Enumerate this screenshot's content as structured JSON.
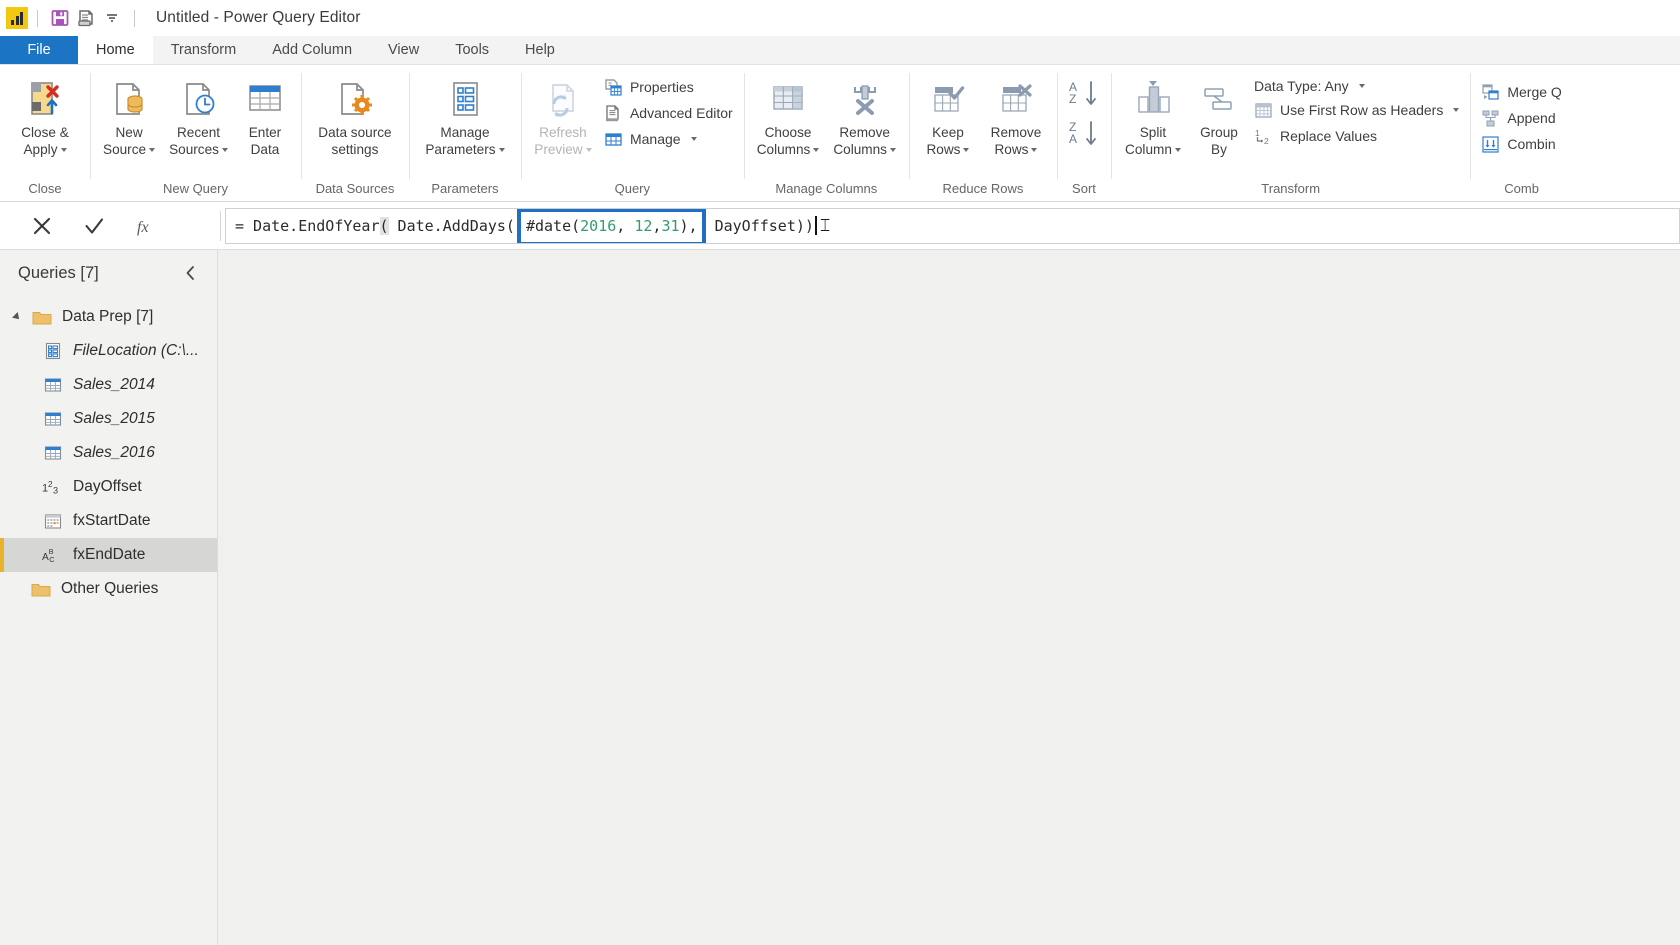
{
  "titlebar": {
    "app_icon": "power-bi-logo",
    "save_icon": "save-floppy-icon",
    "print_icon": "print-document-icon",
    "overflow_icon": "quick-access-dropdown-icon",
    "title": "Untitled - Power Query Editor"
  },
  "tabs": [
    {
      "label": "File",
      "kind": "file",
      "active": false
    },
    {
      "label": "Home",
      "kind": "normal",
      "active": true
    },
    {
      "label": "Transform",
      "kind": "normal",
      "active": false
    },
    {
      "label": "Add Column",
      "kind": "normal",
      "active": false
    },
    {
      "label": "View",
      "kind": "normal",
      "active": false
    },
    {
      "label": "Tools",
      "kind": "normal",
      "active": false
    },
    {
      "label": "Help",
      "kind": "normal",
      "active": false
    }
  ],
  "ribbon": {
    "groups": [
      {
        "name": "Close",
        "label": "Close",
        "big": [
          {
            "label": "Close &\nApply",
            "icon": "close-and-apply-icon",
            "caret": true,
            "disabled": false
          }
        ]
      },
      {
        "name": "New Query",
        "label": "New Query",
        "big": [
          {
            "label": "New\nSource",
            "icon": "new-source-icon",
            "caret": true,
            "disabled": false
          },
          {
            "label": "Recent\nSources",
            "icon": "recent-sources-icon",
            "caret": true,
            "disabled": false
          },
          {
            "label": "Enter\nData",
            "icon": "enter-data-icon",
            "caret": false,
            "disabled": false
          }
        ]
      },
      {
        "name": "Data Sources",
        "label": "Data Sources",
        "big": [
          {
            "label": "Data source\nsettings",
            "icon": "data-source-settings-icon",
            "caret": false,
            "disabled": false
          }
        ]
      },
      {
        "name": "Parameters",
        "label": "Parameters",
        "big": [
          {
            "label": "Manage\nParameters",
            "icon": "manage-parameters-icon",
            "caret": true,
            "disabled": false
          }
        ]
      },
      {
        "name": "Query",
        "label": "Query",
        "big": [
          {
            "label": "Refresh\nPreview",
            "icon": "refresh-preview-icon",
            "caret": true,
            "disabled": true
          }
        ],
        "small": [
          {
            "label": "Properties",
            "icon": "properties-icon",
            "caret": false
          },
          {
            "label": "Advanced Editor",
            "icon": "advanced-editor-icon",
            "caret": false
          },
          {
            "label": "Manage",
            "icon": "manage-icon",
            "caret": true
          }
        ]
      },
      {
        "name": "Manage Columns",
        "label": "Manage Columns",
        "big": [
          {
            "label": "Choose\nColumns",
            "icon": "choose-columns-icon",
            "caret": true,
            "disabled": false
          },
          {
            "label": "Remove\nColumns",
            "icon": "remove-columns-icon",
            "caret": true,
            "disabled": false
          }
        ]
      },
      {
        "name": "Reduce Rows",
        "label": "Reduce Rows",
        "big": [
          {
            "label": "Keep\nRows",
            "icon": "keep-rows-icon",
            "caret": true,
            "disabled": false
          },
          {
            "label": "Remove\nRows",
            "icon": "remove-rows-icon",
            "caret": true,
            "disabled": false
          }
        ]
      },
      {
        "name": "Sort",
        "label": "Sort",
        "sort": [
          {
            "icon": "sort-ascending-icon",
            "label": "A to Z"
          },
          {
            "icon": "sort-descending-icon",
            "label": "Z to A"
          }
        ]
      },
      {
        "name": "Transform",
        "label": "Transform",
        "big": [
          {
            "label": "Split\nColumn",
            "icon": "split-column-icon",
            "caret": true,
            "disabled": false
          },
          {
            "label": "Group\nBy",
            "icon": "group-by-icon",
            "caret": false,
            "disabled": false
          }
        ],
        "small": [
          {
            "label": "Data Type: Any",
            "icon": "",
            "caret": true
          },
          {
            "label": "Use First Row as Headers",
            "icon": "use-first-row-as-headers-icon",
            "caret": true
          },
          {
            "label": "Replace Values",
            "icon": "replace-values-icon",
            "caret": false
          }
        ]
      },
      {
        "name": "Combine",
        "label": "Comb",
        "small": [
          {
            "label": "Merge Q",
            "icon": "merge-queries-icon",
            "caret": false
          },
          {
            "label": "Append",
            "icon": "append-queries-icon",
            "caret": false
          },
          {
            "label": "Combin",
            "icon": "combine-files-icon",
            "caret": false
          }
        ]
      }
    ]
  },
  "formula_bar": {
    "cancel_icon": "cancel-x-icon",
    "accept_icon": "accept-check-icon",
    "fx_icon": "fx-icon",
    "equals": "=",
    "seg_before": " Date.EndOfYear",
    "open_paren": "(",
    "seg_mid": " Date.AddDays(",
    "highlighted": {
      "fn": "#date(",
      "year": "2016",
      "comma1": ", ",
      "month": "12",
      "comma2": ",",
      "day": "31",
      "tail": "),"
    },
    "seg_after": " DayOffset))",
    "full_text": "= Date.EndOfYear( Date.AddDays( #date(2016, 12,31), DayOffset))",
    "highlight_color": "#1f6fc4"
  },
  "sidebar": {
    "title": "Queries [7]",
    "collapse_icon": "chevron-left-icon",
    "items": [
      {
        "label": "Data Prep [7]",
        "icon": "folder-icon",
        "level": "group",
        "italic": false,
        "selected": false
      },
      {
        "label": "FileLocation (C:\\...",
        "icon": "parameter-icon",
        "level": "child",
        "italic": true,
        "selected": false
      },
      {
        "label": "Sales_2014",
        "icon": "table-icon",
        "level": "child",
        "italic": true,
        "selected": false
      },
      {
        "label": "Sales_2015",
        "icon": "table-icon",
        "level": "child",
        "italic": true,
        "selected": false
      },
      {
        "label": "Sales_2016",
        "icon": "table-icon",
        "level": "child",
        "italic": true,
        "selected": false
      },
      {
        "label": "DayOffset",
        "icon": "number-123-icon",
        "level": "child",
        "italic": false,
        "selected": false
      },
      {
        "label": "fxStartDate",
        "icon": "date-icon",
        "level": "child",
        "italic": false,
        "selected": false
      },
      {
        "label": "fxEndDate",
        "icon": "text-abc-icon",
        "level": "child",
        "italic": false,
        "selected": true
      },
      {
        "label": "Other Queries",
        "icon": "folder-icon",
        "level": "group-child",
        "italic": false,
        "selected": false
      }
    ],
    "selected_accent": "#e8b32a"
  },
  "canvas": {
    "background": "#f0f0ee"
  }
}
